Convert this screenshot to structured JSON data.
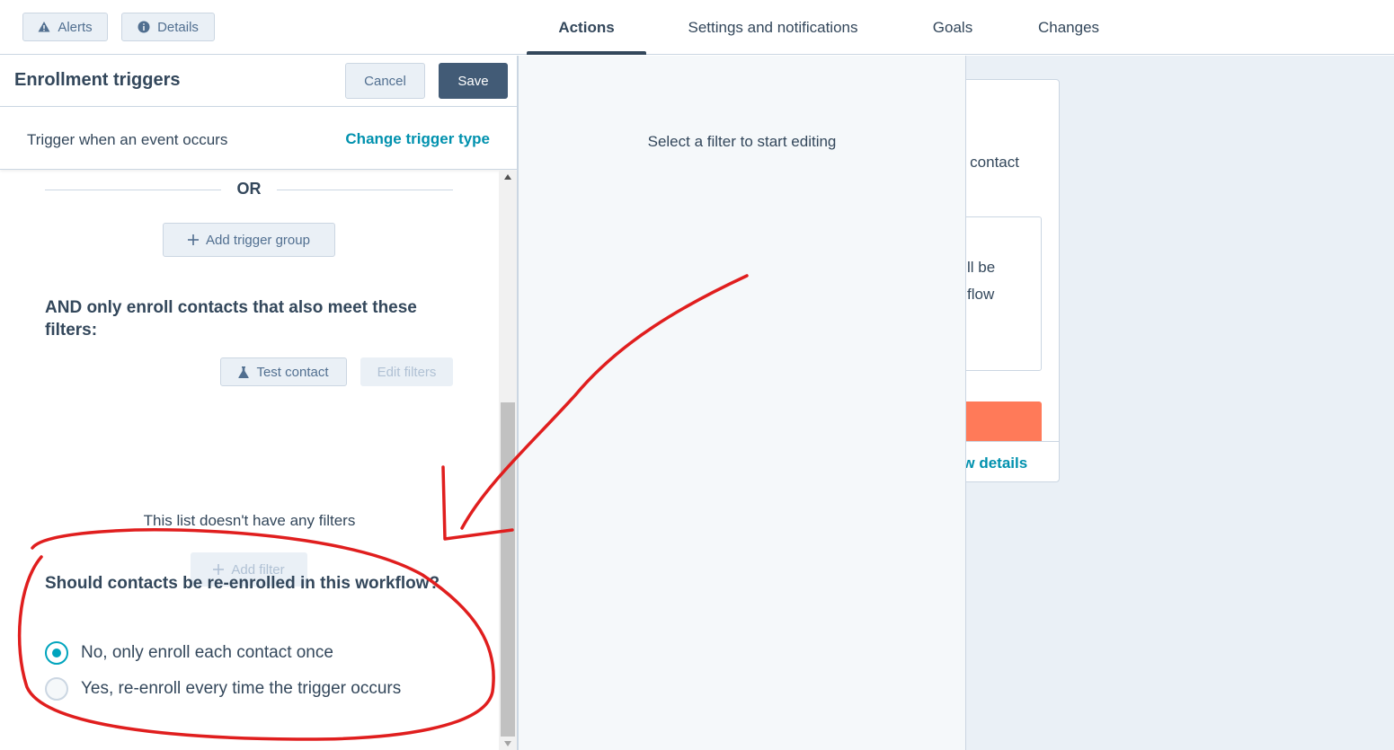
{
  "topbar": {
    "alerts_label": "Alerts",
    "details_label": "Details",
    "tabs": [
      {
        "label": "Actions",
        "active": true
      },
      {
        "label": "Settings and notifications",
        "active": false
      },
      {
        "label": "Goals",
        "active": false
      },
      {
        "label": "Changes",
        "active": false
      }
    ]
  },
  "enrollment_panel": {
    "title": "Enrollment triggers",
    "cancel_label": "Cancel",
    "save_label": "Save",
    "trigger_text": "Trigger when an event occurs",
    "change_trigger_label": "Change trigger type",
    "or_label": "OR",
    "add_trigger_group_label": "Add trigger group",
    "filters_heading": "AND only enroll contacts that also meet these filters:",
    "test_contact_label": "Test contact",
    "edit_filters_label": "Edit filters",
    "no_filters_text": "This list doesn't have any filters",
    "add_filter_label": "Add filter",
    "reenroll_heading": "Should contacts be re-enrolled in this workflow?",
    "reenroll_options": [
      {
        "label": "No, only enroll each contact once",
        "selected": true
      },
      {
        "label": "Yes, re-enroll every time the trigger occurs",
        "selected": false
      }
    ]
  },
  "filter_editor": {
    "placeholder_message": "Select a filter to start editing"
  },
  "background_card": {
    "fragment_1": "a contact",
    "fragment_2": "ll be",
    "fragment_3": "flow",
    "fragment_4": "ow details"
  },
  "colors": {
    "accent_teal": "#00a4bd",
    "link_teal": "#0091ae",
    "save_button": "#425b76",
    "orange": "#ff7a59",
    "annotation_red": "#e01e1e"
  },
  "icons": {
    "alerts": "warning-triangle-icon",
    "details": "info-circle-icon",
    "add": "plus-icon",
    "test": "flask-icon"
  }
}
